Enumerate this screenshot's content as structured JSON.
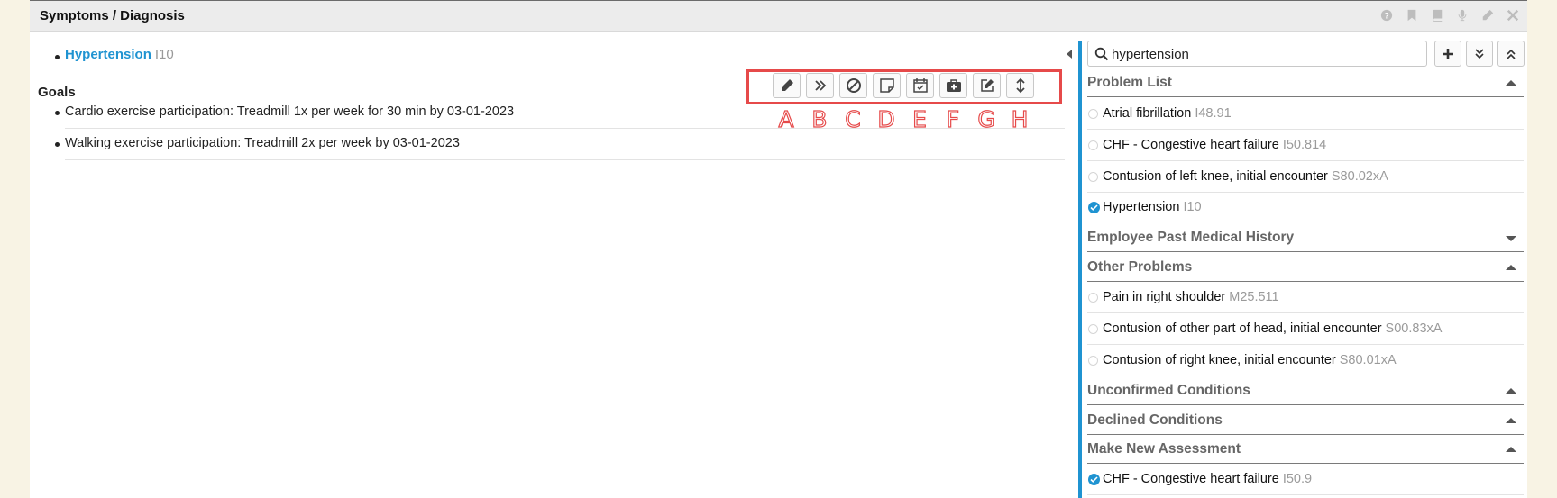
{
  "panel": {
    "title": "Symptoms / Diagnosis",
    "header_icons": [
      "help-icon",
      "bookmark-icon",
      "book-icon",
      "microphone-icon",
      "pencil-icon",
      "close-icon"
    ]
  },
  "diagnosis": {
    "name": "Hypertension",
    "code": "I10"
  },
  "toolbar": {
    "buttons": [
      {
        "icon": "pencil-icon",
        "label": "A"
      },
      {
        "icon": "double-chevron-right-icon",
        "label": "B"
      },
      {
        "icon": "ban-icon",
        "label": "C"
      },
      {
        "icon": "sticky-note-icon",
        "label": "D"
      },
      {
        "icon": "calendar-check-icon",
        "label": "E"
      },
      {
        "icon": "medical-kit-icon",
        "label": "F"
      },
      {
        "icon": "edit-square-icon",
        "label": "G"
      },
      {
        "icon": "vertical-arrows-icon",
        "label": "H"
      }
    ],
    "highlight_color": "#e64a4a"
  },
  "goals": {
    "title": "Goals",
    "items": [
      "Cardio exercise participation: Treadmill 1x per week for 30 min by 03-01-2023",
      "Walking exercise participation: Treadmill 2x per week by 03-01-2023"
    ]
  },
  "search": {
    "value": "hypertension"
  },
  "sections": {
    "problem_list": {
      "title": "Problem List",
      "items": [
        {
          "name": "Atrial fibrillation",
          "code": "I48.91",
          "selected": false
        },
        {
          "name": "CHF - Congestive heart failure",
          "code": "I50.814",
          "selected": false
        },
        {
          "name": "Contusion of left knee, initial encounter",
          "code": "S80.02xA",
          "selected": false
        },
        {
          "name": "Hypertension",
          "code": "I10",
          "selected": true
        }
      ]
    },
    "employee_past": {
      "title": "Employee Past Medical History"
    },
    "other_problems": {
      "title": "Other Problems",
      "items": [
        {
          "name": "Pain in right shoulder",
          "code": "M25.511",
          "selected": false
        },
        {
          "name": "Contusion of other part of head, initial encounter",
          "code": "S00.83xA",
          "selected": false
        },
        {
          "name": "Contusion of right knee, initial encounter",
          "code": "S80.01xA",
          "selected": false
        }
      ]
    },
    "unconfirmed": {
      "title": "Unconfirmed Conditions"
    },
    "declined": {
      "title": "Declined Conditions"
    },
    "new_assessment": {
      "title": "Make New Assessment",
      "items": [
        {
          "name": "CHF - Congestive heart failure",
          "code": "I50.9",
          "selected": true
        }
      ]
    }
  },
  "colors": {
    "accent": "#1f93d1",
    "header_bg": "#ececec",
    "page_bg": "#f8f3e4"
  }
}
